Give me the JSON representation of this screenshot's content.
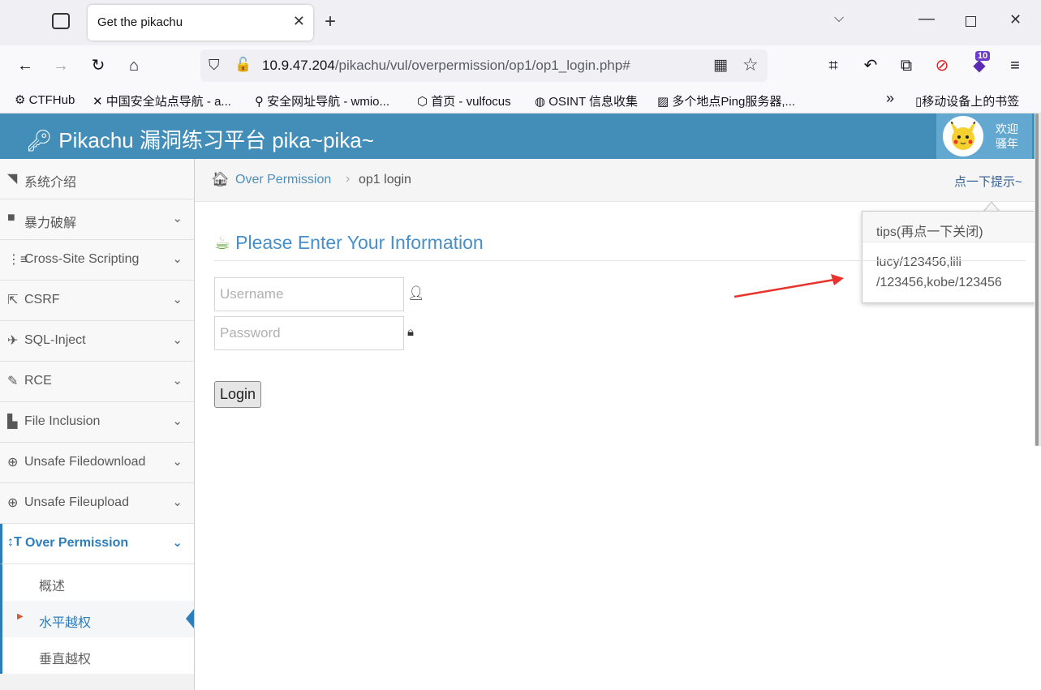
{
  "browser": {
    "tab_title": "Get the pikachu",
    "url_host": "10.9.47.204",
    "url_path": "/pikachu/vul/overpermission/op1/op1_login.php#",
    "extension_badge": "10",
    "bookmarks": [
      "CTFHub",
      "中国安全站点导航 - a...",
      "安全网址导航 - wmio...",
      "首页 - vulfocus",
      "OSINT 信息收集",
      "多个地点Ping服务器,...",
      "移动设备上的书签"
    ]
  },
  "header": {
    "brand": "Pikachu 漏洞练习平台 pika~pika~",
    "welcome_line1": "欢迎",
    "welcome_line2": "骚年"
  },
  "sidebar": {
    "items": [
      {
        "label": "系统介绍",
        "icon": "tags-icon"
      },
      {
        "label": "暴力破解",
        "icon": "lock-icon"
      },
      {
        "label": "Cross-Site Scripting",
        "icon": "list-icon"
      },
      {
        "label": "CSRF",
        "icon": "share-icon"
      },
      {
        "label": "SQL-Inject",
        "icon": "plane-icon"
      },
      {
        "label": "RCE",
        "icon": "pencil-icon"
      },
      {
        "label": "File Inclusion",
        "icon": "file-icon"
      },
      {
        "label": "Unsafe Filedownload",
        "icon": "download-icon"
      },
      {
        "label": "Unsafe Fileupload",
        "icon": "upload-icon"
      },
      {
        "label": "Over Permission",
        "icon": "text-height-icon"
      }
    ],
    "subitems": [
      "概述",
      "水平越权",
      "垂直越权"
    ]
  },
  "breadcrumb": {
    "parent": "Over Permission",
    "current": "op1 login",
    "hint": "点一下提示~"
  },
  "tips": {
    "title": "tips(再点一下关闭)",
    "body": "lucy/123456,lili /123456,kobe/123456"
  },
  "form": {
    "title": "Please Enter Your Information",
    "username_placeholder": "Username",
    "password_placeholder": "Password",
    "login_label": "Login"
  },
  "colors": {
    "header": "#438eb9",
    "accent": "#2b7dbc",
    "arrow": "#e8322b"
  }
}
